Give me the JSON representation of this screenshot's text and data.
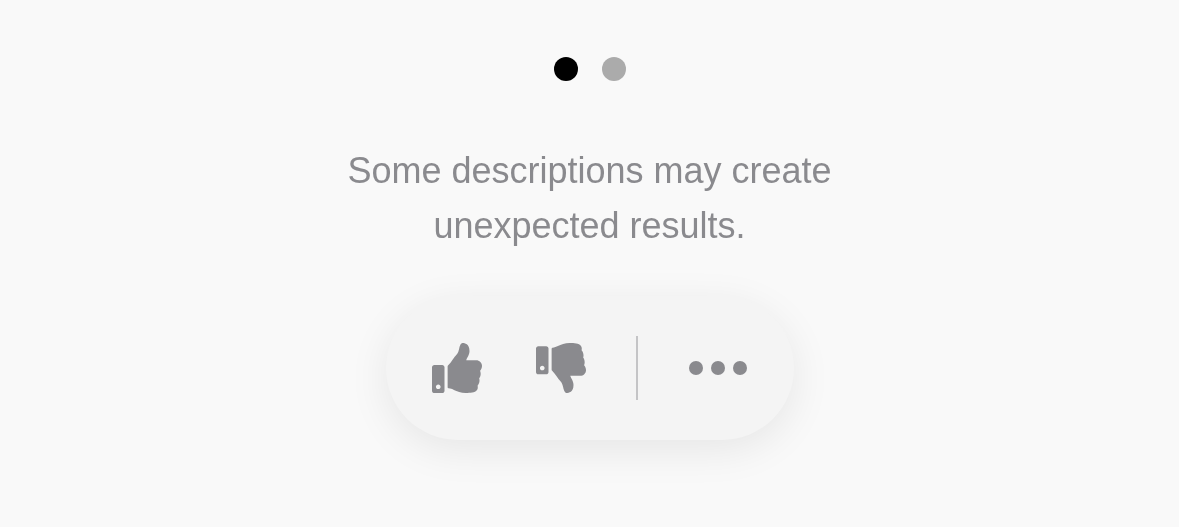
{
  "pages": [
    {
      "selected": true
    },
    {
      "selected": false
    }
  ],
  "message": "Some descriptions may create unexpected results.",
  "feedback_actions": [
    {
      "kind": "like"
    },
    {
      "kind": "dislike"
    },
    {
      "kind": "divider"
    },
    {
      "kind": "more"
    }
  ]
}
